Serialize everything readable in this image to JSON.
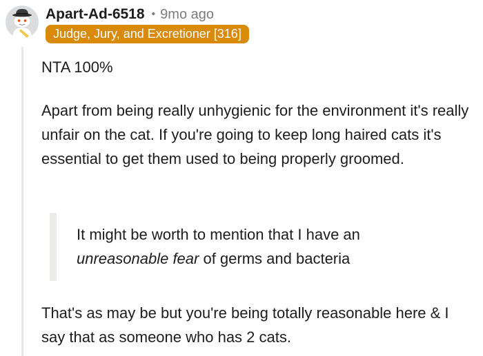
{
  "comment": {
    "author": "Apart-Ad-6518",
    "separator": "•",
    "timestamp": "9mo ago",
    "flair": "Judge, Jury, and Excretioner [316]",
    "avatar_icon": "snoo-detective-avatar",
    "colors": {
      "flair_bg": "#d98a08",
      "flair_text": "#ffffff",
      "meta_gray": "#7c7c7c",
      "thread_line": "#e8e8e8",
      "quote_bar": "#edebe7"
    },
    "paragraphs": [
      "NTA 100%",
      "Apart from being really unhygienic for the environment it's really unfair on the cat. If you're going to keep long haired cats it's essential to get them used to being properly groomed."
    ],
    "quote": {
      "before": "It might be worth to mention that I have an",
      "emphasis": "unreasonable fear",
      "after": " of germs and bacteria"
    },
    "closing": "That's as may be but you're being totally reasonable here & I say that as someone who has 2 cats."
  }
}
